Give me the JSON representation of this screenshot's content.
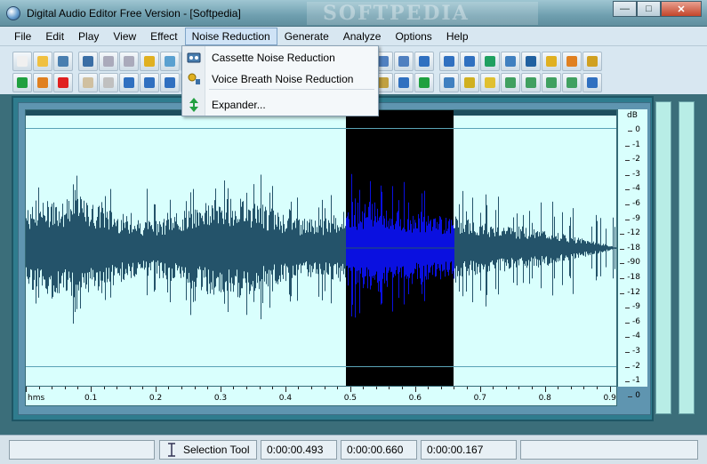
{
  "window": {
    "title": "Digital Audio Editor Free Version - [Softpedia]",
    "watermark": "SOFTPEDIA",
    "min_icon": "minimize-icon",
    "max_icon": "maximize-icon",
    "close_icon": "close-icon"
  },
  "menubar": {
    "items": [
      "File",
      "Edit",
      "Play",
      "View",
      "Effect",
      "Noise Reduction",
      "Generate",
      "Analyze",
      "Options",
      "Help"
    ],
    "active_index": 5
  },
  "dropdown": {
    "items": [
      {
        "label": "Cassette Noise Reduction",
        "icon": "cassette-icon"
      },
      {
        "label": "Voice Breath Noise Reduction",
        "icon": "voice-breath-icon"
      },
      {
        "label": "Expander...",
        "icon": "expander-icon"
      }
    ]
  },
  "waveform": {
    "db_unit": "dB",
    "db_ticks": [
      "0",
      "-1",
      "-2",
      "-3",
      "-4",
      "-6",
      "-9",
      "-12",
      "-18",
      "-90",
      "-18",
      "-12",
      "-9",
      "-6",
      "-4",
      "-3",
      "-2",
      "-1",
      "0"
    ],
    "time_unit": "hms",
    "time_ticks": [
      "0.1",
      "0.2",
      "0.3",
      "0.4",
      "0.5",
      "0.6",
      "0.7",
      "0.8",
      "0.9"
    ],
    "duration_s": 0.913,
    "selection_start_s": 0.493,
    "selection_end_s": 0.66,
    "wave_color": "#24536a",
    "selected_wave_color": "#0a10e0",
    "background_color": "#d9fffd"
  },
  "statusbar": {
    "tool_label": "Selection Tool",
    "selection_start": "0:00:00.493",
    "selection_end": "0:00:00.660",
    "selection_length": "0:00:00.167"
  }
}
